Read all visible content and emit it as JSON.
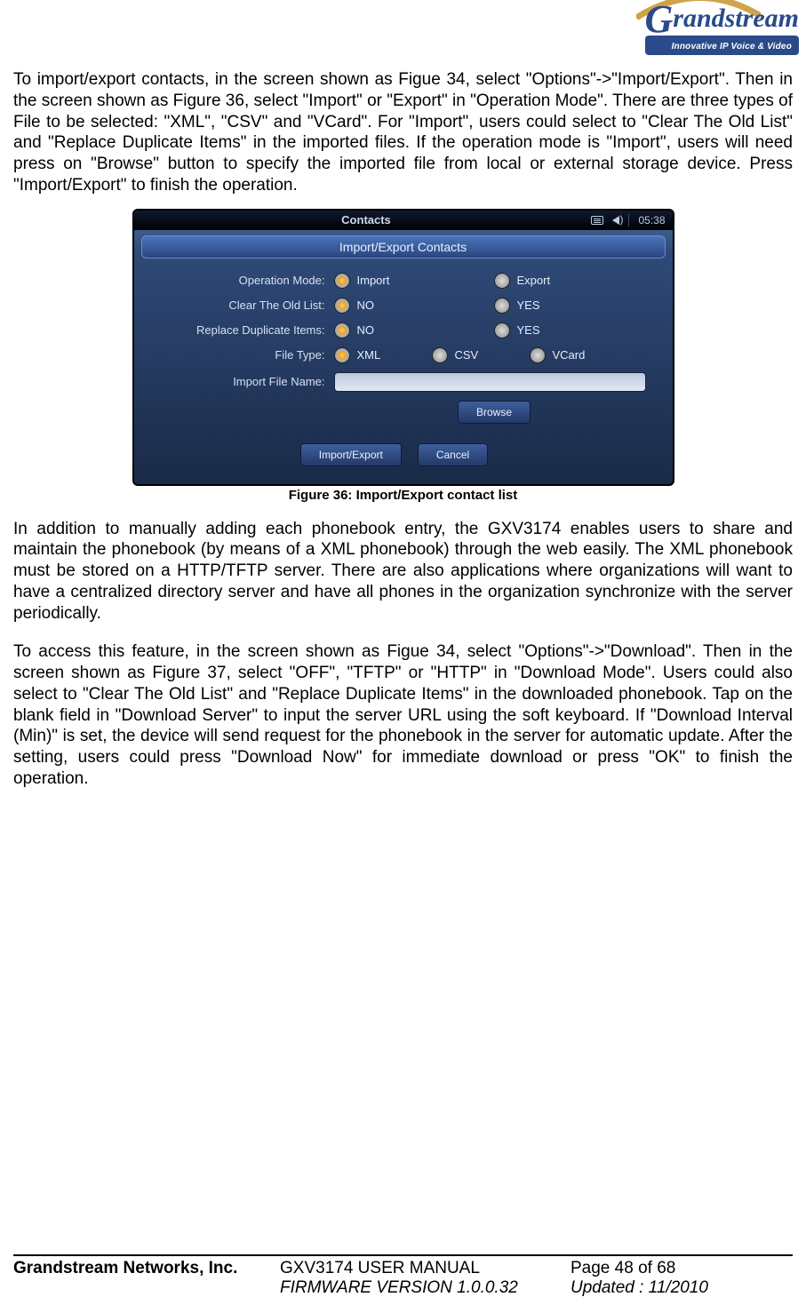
{
  "brand": {
    "name_html": "Grandstream",
    "tagline": "Innovative IP Voice & Video"
  },
  "paragraphs": {
    "p1": "To import/export contacts, in the screen shown as Figue 34, select \"Options\"->\"Import/Export\". Then in the screen shown as Figure 36, select \"Import\" or \"Export\" in \"Operation Mode\". There are three types of File to be selected: \"XML\", \"CSV\" and \"VCard\". For \"Import\", users could select to \"Clear The Old List\" and \"Replace Duplicate Items\" in the imported files. If the operation mode is \"Import\", users will need press on \"Browse\" button to specify the imported file from local or external storage device. Press \"Import/Export\" to finish the operation.",
    "p2": "In addition to manually adding each phonebook entry, the GXV3174 enables users to share and maintain the phonebook (by means of a XML phonebook) through the web easily. The XML phonebook must be stored on a HTTP/TFTP server. There are also applications where organizations will want to have a centralized directory server and have all phones in the organization synchronize with the server periodically.",
    "p3": "To access this feature, in the screen shown as Figue 34, select \"Options\"->\"Download\". Then in the screen shown as Figure 37, select \"OFF\", \"TFTP\" or \"HTTP\" in \"Download Mode\". Users could also select to \"Clear The Old List\" and \"Replace Duplicate Items\" in the downloaded phonebook. Tap on the blank field in \"Download Server\" to input the server URL using the soft keyboard. If \"Download Interval (Min)\" is set, the device will send request for the phonebook in the server for automatic update. After the setting, users could press \"Download Now\" for immediate download or press \"OK\" to finish the operation."
  },
  "figure": {
    "caption": "Figure 36: Import/Export contact list"
  },
  "device": {
    "window_title": "Contacts",
    "clock": "05:38",
    "dialog_title": "Import/Export Contacts",
    "rows": {
      "operation_mode": {
        "label": "Operation Mode:",
        "opt1": "Import",
        "opt2": "Export"
      },
      "clear_old": {
        "label": "Clear The Old List:",
        "opt1": "NO",
        "opt2": "YES"
      },
      "replace_dup": {
        "label": "Replace Duplicate Items:",
        "opt1": "NO",
        "opt2": "YES"
      },
      "file_type": {
        "label": "File Type:",
        "opt1": "XML",
        "opt2": "CSV",
        "opt3": "VCard"
      },
      "import_file": {
        "label": "Import File Name:"
      }
    },
    "buttons": {
      "browse": "Browse",
      "import_export": "Import/Export",
      "cancel": "Cancel"
    }
  },
  "footer": {
    "company": "Grandstream Networks, Inc.",
    "manual": "GXV3174 USER MANUAL",
    "page": "Page 48 of 68",
    "firmware": "FIRMWARE VERSION 1.0.0.32",
    "updated": "Updated : 11/2010"
  }
}
